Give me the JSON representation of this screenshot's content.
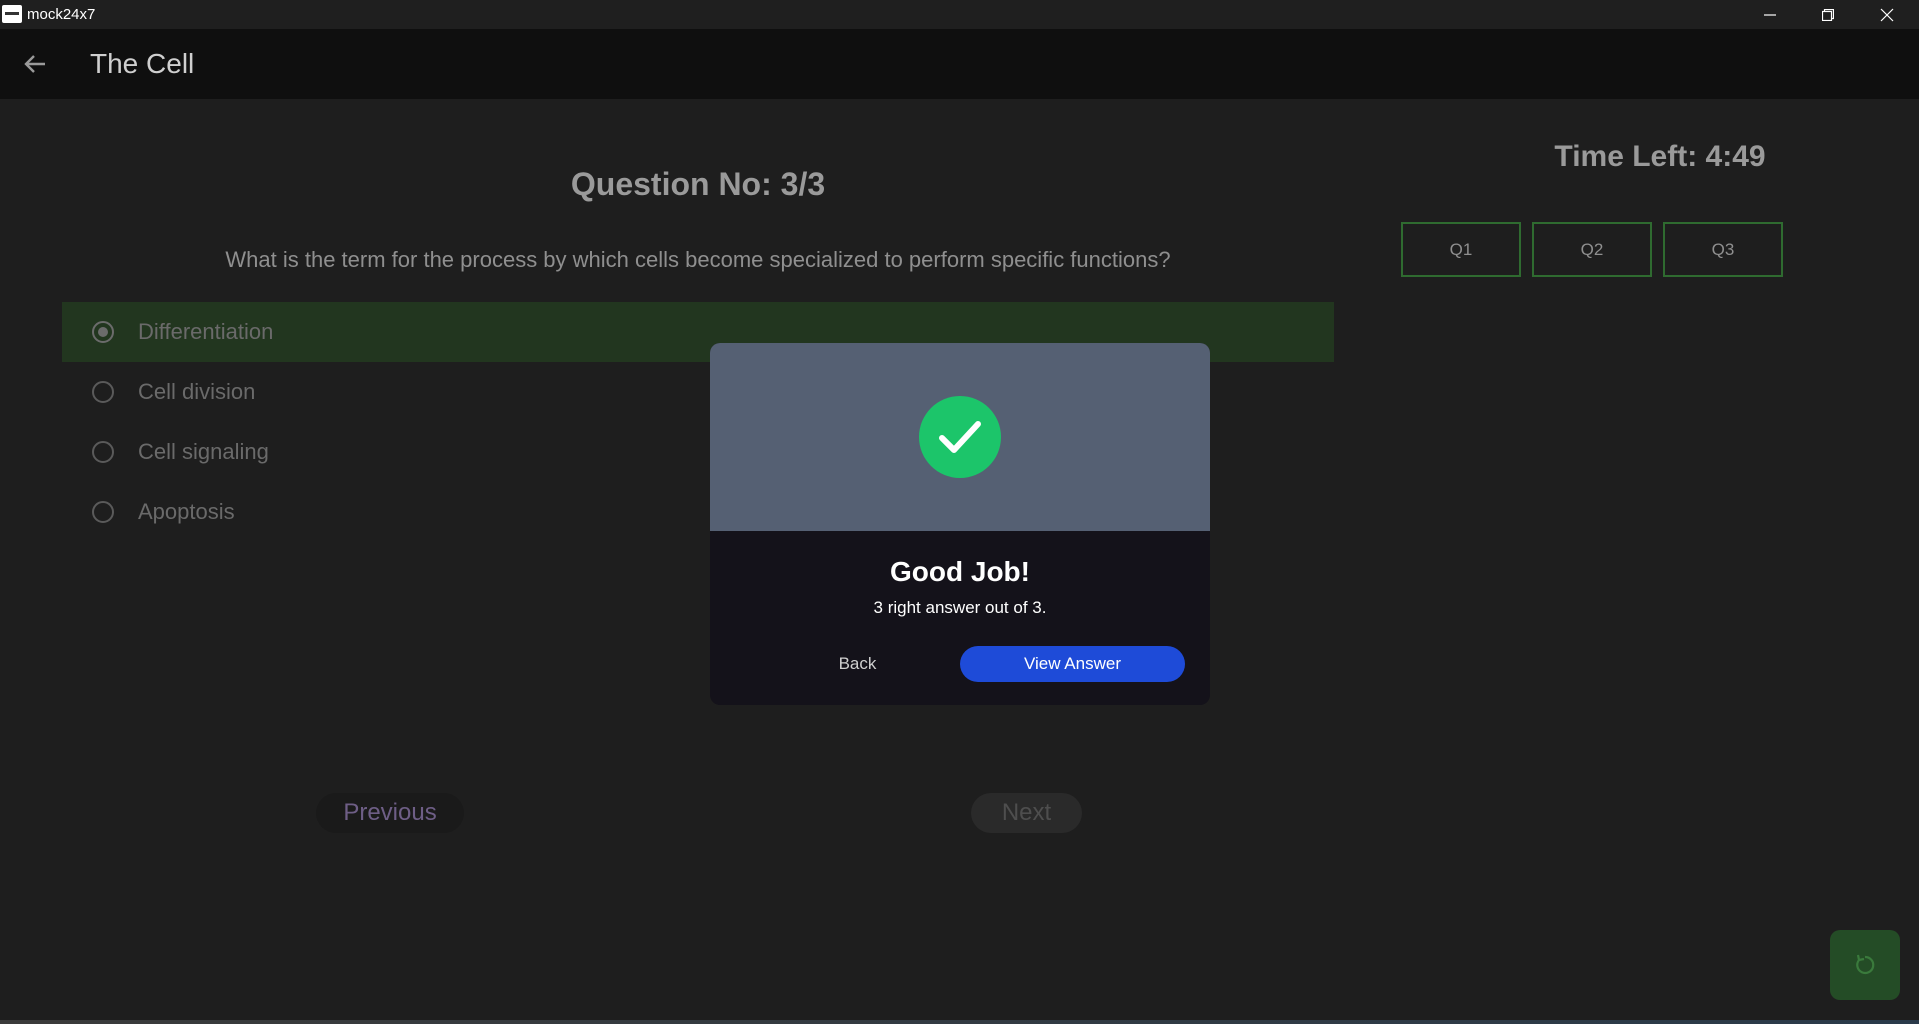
{
  "window": {
    "title": "mock24x7"
  },
  "appbar": {
    "title": "The Cell"
  },
  "question": {
    "number_label": "Question No: 3/3",
    "text": "What is the term for the process by which cells become specialized to perform specific functions?",
    "options": [
      {
        "label": "Differentiation",
        "selected": true
      },
      {
        "label": "Cell division",
        "selected": false
      },
      {
        "label": "Cell signaling",
        "selected": false
      },
      {
        "label": "Apoptosis",
        "selected": false
      }
    ]
  },
  "timer": {
    "label": "Time Left: 4:49"
  },
  "question_tabs": [
    "Q1",
    "Q2",
    "Q3"
  ],
  "navigation": {
    "previous_label": "Previous",
    "next_label": "Next"
  },
  "dialog": {
    "title": "Good Job!",
    "message": "3 right answer out of 3.",
    "back_label": "Back",
    "view_answer_label": "View Answer"
  },
  "colors": {
    "accent_green": "#1cc56a",
    "dialog_button_blue": "#1e4bd8",
    "selected_option_bg": "#22361f",
    "tab_border": "#2f6b30"
  },
  "icons": {
    "back": "arrow-left-icon",
    "success": "check-icon",
    "refresh": "refresh-icon"
  }
}
